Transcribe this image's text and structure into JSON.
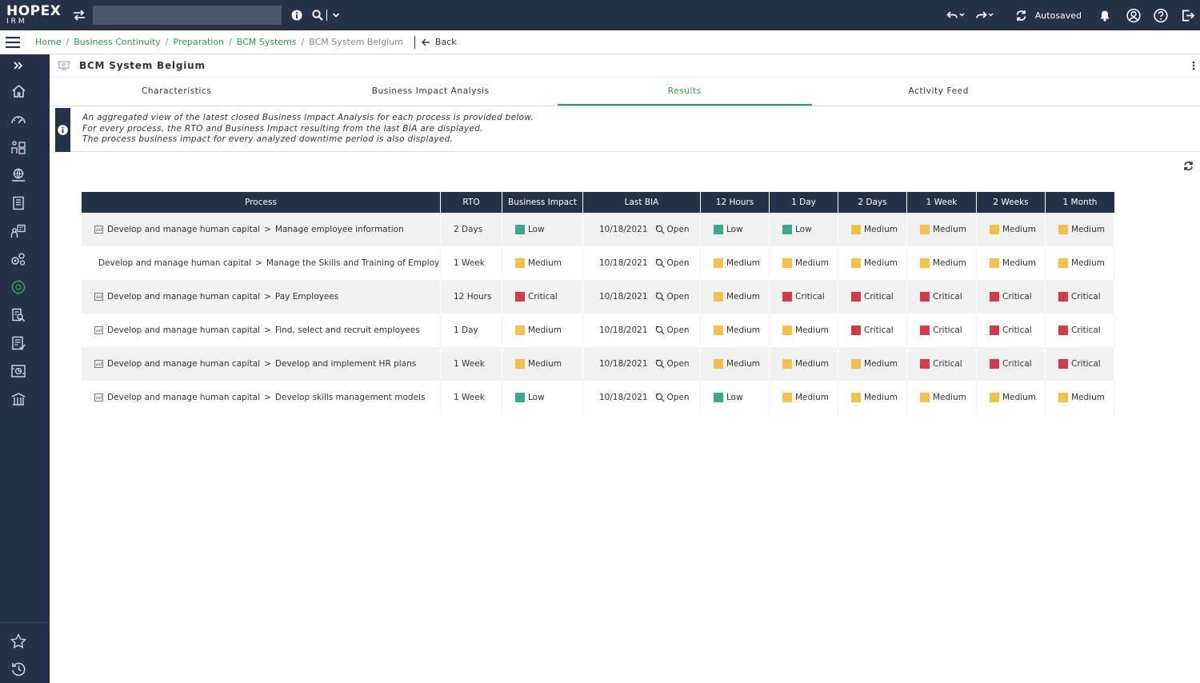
{
  "app": {
    "brand": "HOPEX",
    "product": "IRM",
    "autosaved": "Autosaved"
  },
  "colors": {
    "navy": "#253247",
    "green": "#2e9a55",
    "low": "#3aaa8c",
    "medium": "#f5c04e",
    "critical": "#d23c4a"
  },
  "breadcrumb": {
    "items": [
      "Home",
      "Business Continuity",
      "Preparation",
      "BCM Systems"
    ],
    "current": "BCM System Belgium",
    "back": "Back"
  },
  "page": {
    "title": "BCM System Belgium",
    "tabs": [
      {
        "label": "Characteristics",
        "active": false
      },
      {
        "label": "Business Impact Analysis",
        "active": false
      },
      {
        "label": "Results",
        "active": true
      },
      {
        "label": "Activity Feed",
        "active": false
      }
    ],
    "info_lines": [
      "An aggregated view of the latest closed Business Impact Analysis for each process is provided below.",
      "For every process, the RTO and Business Impact resulting from the last BIA are displayed.",
      "The process business impact for every analyzed downtime period is also displayed."
    ]
  },
  "sidebar": {
    "icons": [
      "expand-icon",
      "home-icon",
      "dashboard-icon",
      "organization-icon",
      "environment-icon",
      "library-icon",
      "assessment-icon",
      "settings-group-icon",
      "business-continuity-icon",
      "audit-icon",
      "checklist-icon",
      "report-icon",
      "regulation-icon"
    ],
    "bottom_icons": [
      "favorites-icon",
      "history-icon"
    ]
  },
  "table": {
    "columns": [
      "Process",
      "RTO",
      "Business Impact",
      "Last BIA",
      "12 Hours",
      "1 Day",
      "2 Days",
      "1 Week",
      "2 Weeks",
      "1 Month"
    ],
    "rows": [
      {
        "parent": "Develop and manage human capital",
        "process": "Manage employee information",
        "rto": "2 Days",
        "impact": "Low",
        "last_bia": "10/18/2021",
        "open": "Open",
        "levels": [
          "Low",
          "Low",
          "Medium",
          "Medium",
          "Medium",
          "Medium"
        ]
      },
      {
        "parent": "Develop and manage human capital",
        "process": "Manage the Skills and Training of Employees",
        "rto": "1 Week",
        "impact": "Medium",
        "last_bia": "10/18/2021",
        "open": "Open",
        "levels": [
          "Medium",
          "Medium",
          "Medium",
          "Medium",
          "Medium",
          "Medium"
        ]
      },
      {
        "parent": "Develop and manage human capital",
        "process": "Pay Employees",
        "rto": "12 Hours",
        "impact": "Critical",
        "last_bia": "10/18/2021",
        "open": "Open",
        "levels": [
          "Medium",
          "Critical",
          "Critical",
          "Critical",
          "Critical",
          "Critical"
        ]
      },
      {
        "parent": "Develop and manage human capital",
        "process": "Find, select and recruit employees",
        "rto": "1 Day",
        "impact": "Medium",
        "last_bia": "10/18/2021",
        "open": "Open",
        "levels": [
          "Medium",
          "Medium",
          "Critical",
          "Critical",
          "Critical",
          "Critical"
        ]
      },
      {
        "parent": "Develop and manage human capital",
        "process": "Develop and implement HR plans",
        "rto": "1 Week",
        "impact": "Medium",
        "last_bia": "10/18/2021",
        "open": "Open",
        "levels": [
          "Medium",
          "Medium",
          "Medium",
          "Critical",
          "Critical",
          "Critical"
        ]
      },
      {
        "parent": "Develop and manage human capital",
        "process": "Develop skills management models",
        "rto": "1 Week",
        "impact": "Low",
        "last_bia": "10/18/2021",
        "open": "Open",
        "levels": [
          "Low",
          "Medium",
          "Medium",
          "Medium",
          "Medium",
          "Medium"
        ]
      }
    ]
  }
}
